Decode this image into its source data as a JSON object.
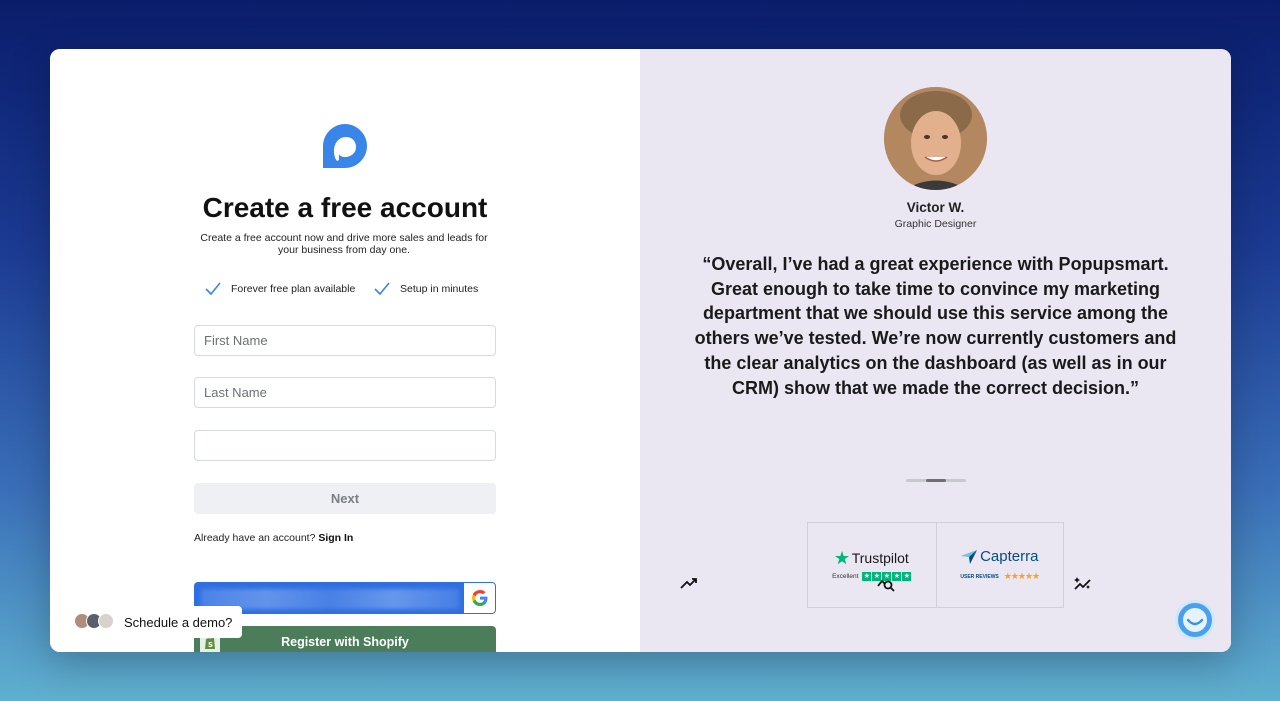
{
  "signup": {
    "title": "Create a free account",
    "subtitle": "Create a free account now and drive more sales and leads for your business from day one.",
    "features": [
      "Forever free plan available",
      "Setup in minutes"
    ],
    "first_name_placeholder": "First Name",
    "last_name_placeholder": "Last Name",
    "email_placeholder": "",
    "next_label": "Next",
    "already_text": "Already have an account?",
    "sign_in_label": "Sign In",
    "shopify_label": "Register with Shopify"
  },
  "demo": {
    "label": "Schedule a demo?"
  },
  "testimonial": {
    "name": "Victor W.",
    "role": "Graphic Designer",
    "quote": "“Overall, I’ve had a great experience with Popupsmart. Great enough to take time to convince my marketing department that we should use this service among the others we’ve tested. We’re now currently customers and the clear analytics on the dashboard (as well as in our CRM) show that we made the correct decision.”"
  },
  "reviews": {
    "trustpilot_name": "Trustpilot",
    "trustpilot_rating": "Excellent",
    "capterra_name": "Capterra",
    "capterra_sub": "USER REVIEWS"
  },
  "colors": {
    "brand": "#3a86e8",
    "testimonial_bg": "#eae7f2",
    "shopify_green": "#4c7d5b",
    "google_blue": "#2f6fe0",
    "trustpilot_green": "#00b67a",
    "capterra_orange": "#ff9d28"
  },
  "icons": [
    "check-icon",
    "google-icon",
    "shopify-icon",
    "trend-up-icon",
    "analytics-search-icon",
    "sparkle-chart-icon",
    "chat-widget-icon"
  ]
}
